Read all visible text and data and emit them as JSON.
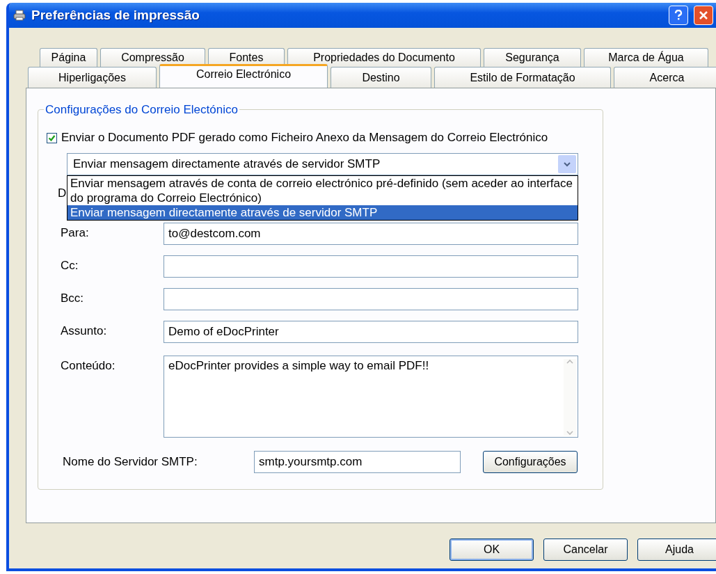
{
  "window": {
    "title": "Preferências de impressão"
  },
  "tab_rows": [
    [
      {
        "label": "Página",
        "selected": false
      },
      {
        "label": "Compressão",
        "selected": false
      },
      {
        "label": "Fontes",
        "selected": false
      },
      {
        "label": "Propriedades do Documento",
        "selected": false
      },
      {
        "label": "Segurança",
        "selected": false
      },
      {
        "label": "Marca de Água",
        "selected": false
      }
    ],
    [
      {
        "label": "Hiperligações",
        "selected": false
      },
      {
        "label": "Correio Electrónico",
        "selected": true
      },
      {
        "label": "Destino",
        "selected": false
      },
      {
        "label": "Estilo de Formatação",
        "selected": false
      },
      {
        "label": "Acerca",
        "selected": false
      }
    ]
  ],
  "group": {
    "title": "Configurações do Correio Electónico",
    "attach_checkbox": {
      "label": "Enviar o Documento PDF gerado como Ficheiro Anexo da Mensagem do Correio Electrónico",
      "checked": true
    },
    "send_method": {
      "value": "Enviar mensagem directamente através de servidor SMTP",
      "expanded": true,
      "options": [
        {
          "label": "Enviar mensagem através de conta de correio electrónico pré-definido (sem aceder ao interface do programa do Correio Electrónico)",
          "selected": false
        },
        {
          "label": "Enviar mensagem directamente através de servidor SMTP",
          "selected": true
        }
      ]
    },
    "hidden_label": "D",
    "fields": [
      {
        "label": "Para:",
        "value": "to@destcom.com"
      },
      {
        "label": "Cc:"
      },
      {
        "label": "Bcc:"
      },
      {
        "label": "Assunto:",
        "value": "Demo of eDocPrinter"
      }
    ],
    "content": {
      "label": "Conteúdo:",
      "value": "eDocPrinter provides a simple way to email PDF!!"
    },
    "smtp": {
      "label": "Nome do Servidor SMTP:",
      "value": "smtp.yoursmtp.com",
      "button": "Configurações"
    }
  },
  "buttons": [
    "OK",
    "Cancelar",
    "Ajuda"
  ]
}
